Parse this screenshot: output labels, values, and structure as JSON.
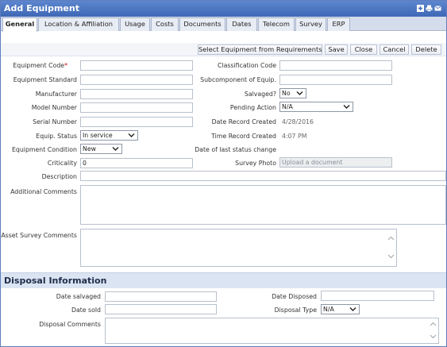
{
  "window": {
    "title": "Add Equipment"
  },
  "titlebar_icons": [
    "add-icon",
    "print-icon",
    "email-icon"
  ],
  "tabs": [
    {
      "label": "General"
    },
    {
      "label": "Location & Affiliation"
    },
    {
      "label": "Usage"
    },
    {
      "label": "Costs"
    },
    {
      "label": "Documents"
    },
    {
      "label": "Dates"
    },
    {
      "label": "Telecom"
    },
    {
      "label": "Survey"
    },
    {
      "label": "ERP"
    }
  ],
  "toolbar": {
    "select_requirements": "Select Equipment from Requirements",
    "save": "Save",
    "close": "Close",
    "cancel": "Cancel",
    "delete": "Delete"
  },
  "form": {
    "equipment_code": {
      "label": "Equipment Code",
      "required_mark": "*",
      "value": ""
    },
    "equipment_standard": {
      "label": "Equipment Standard",
      "value": ""
    },
    "manufacturer": {
      "label": "Manufacturer",
      "value": ""
    },
    "model_number": {
      "label": "Model Number",
      "value": ""
    },
    "serial_number": {
      "label": "Serial Number",
      "value": ""
    },
    "equip_status": {
      "label": "Equip. Status",
      "value": "In service"
    },
    "equipment_condition": {
      "label": "Equipment Condition",
      "value": "New"
    },
    "criticality": {
      "label": "Criticality",
      "value": "0"
    },
    "description": {
      "label": "Description",
      "value": ""
    },
    "additional_comments": {
      "label": "Additional Comments",
      "value": ""
    },
    "asset_survey_comments": {
      "label": "Asset Survey Comments",
      "value": ""
    },
    "classification_code": {
      "label": "Classification Code",
      "value": ""
    },
    "subcomponent": {
      "label": "Subcomponent of Equip.",
      "value": ""
    },
    "salvaged": {
      "label": "Salvaged?",
      "value": "No"
    },
    "pending_action": {
      "label": "Pending Action",
      "value": "N/A"
    },
    "date_record_created": {
      "label": "Date Record Created",
      "value": "4/28/2016"
    },
    "time_record_created": {
      "label": "Time Record Created",
      "value": "4:07 PM"
    },
    "date_last_status_change": {
      "label": "Date of last status change",
      "value": ""
    },
    "survey_photo": {
      "label": "Survey Photo",
      "value": "Upload a document"
    }
  },
  "disposal": {
    "header": "Disposal Information",
    "date_salvaged": {
      "label": "Date salvaged",
      "value": ""
    },
    "date_sold": {
      "label": "Date sold",
      "value": ""
    },
    "date_disposed": {
      "label": "Date Disposed",
      "value": ""
    },
    "disposal_type": {
      "label": "Disposal Type",
      "value": "N/A"
    },
    "disposal_comments": {
      "label": "Disposal Comments",
      "value": ""
    }
  }
}
